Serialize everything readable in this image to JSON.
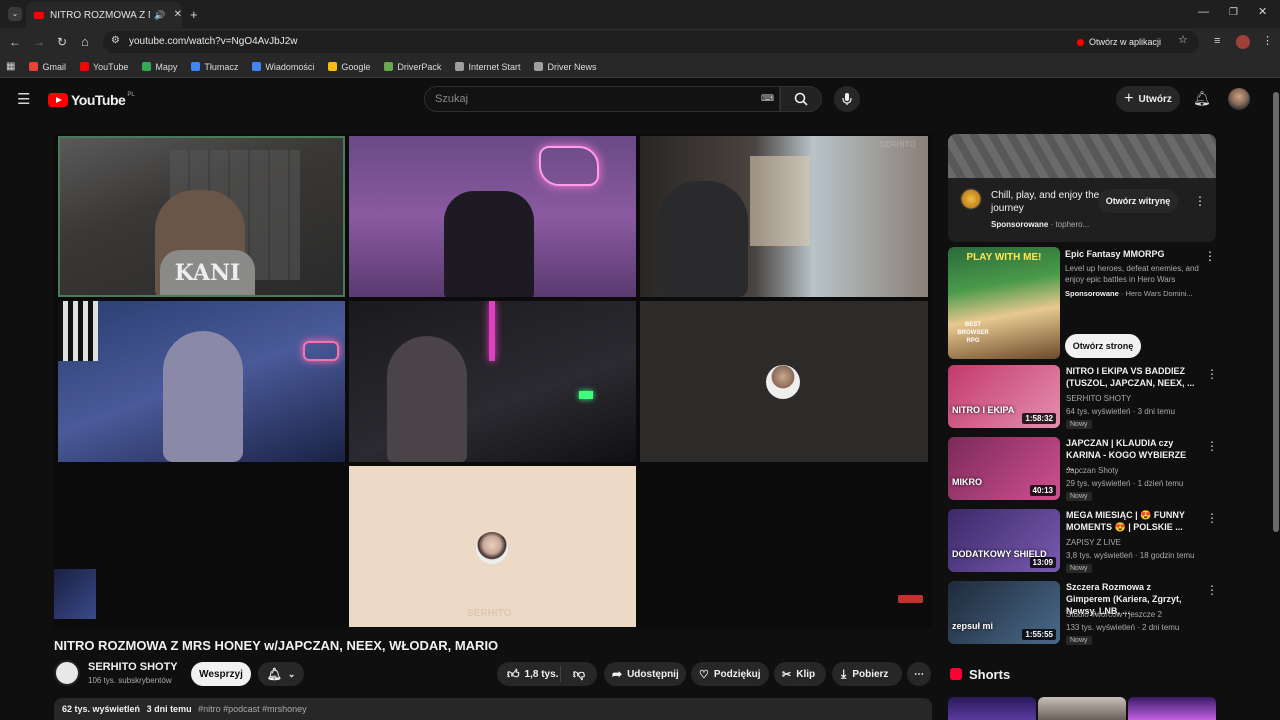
{
  "browser": {
    "tab_title": "NITRO ROZMOWA Z MRS H",
    "url": "youtube.com/watch?v=NgO4AvJbJ2w",
    "open_in_app": "Otwórz w aplikacji",
    "bookmarks": [
      {
        "label": "Gmail",
        "color": "#ea4335"
      },
      {
        "label": "YouTube",
        "color": "#ff0000"
      },
      {
        "label": "Mapy",
        "color": "#34a853"
      },
      {
        "label": "Tłumacz",
        "color": "#4285f4"
      },
      {
        "label": "Wiadomości",
        "color": "#4285f4"
      },
      {
        "label": "Google",
        "color": "#fbbc05"
      },
      {
        "label": "DriverPack",
        "color": "#6aa84f"
      },
      {
        "label": "Internet Start",
        "color": "#9e9e9e"
      },
      {
        "label": "Driver News",
        "color": "#9e9e9e"
      }
    ]
  },
  "header": {
    "logo": "YouTube",
    "logo_region": "PL",
    "search_placeholder": "Szukaj",
    "create_label": "Utwórz"
  },
  "video": {
    "title": "NITRO ROZMOWA Z MRS HONEY w/JAPCZAN, NEEX, WŁODAR, MARIO",
    "channel": "SERHITO SHOTY",
    "subscribers": "106 tys. subskrybentów",
    "support_label": "Wesprzyj",
    "likes": "1,8 tys.",
    "share_label": "Udostępnij",
    "thanks_label": "Podziękuj",
    "clip_label": "Klip",
    "download_label": "Pobierz",
    "views": "62 tys. wyświetleń",
    "date": "3 dni temu",
    "tags": "#nitro #podcast #mrshoney",
    "watermark": "SERHITO",
    "cam_text": "KANI"
  },
  "sidebar": {
    "ad": {
      "title": "Chill, play, and enjoy the journey",
      "sponsored": "Sponsorowane",
      "domain": "tophero...",
      "button": "Otwórz witrynę"
    },
    "ad2": {
      "title": "Epic Fantasy MMORPG",
      "desc": "Level up heroes, defeat enemies, and enjoy epic battles in Hero Wars",
      "sponsored": "Sponsorowane",
      "advertiser": "Hero Wars Domini...",
      "button": "Otwórz stronę",
      "thumb_text": "PLAY WITH ME!",
      "thumb_badge": "BEST BROWSER RPG"
    },
    "videos": [
      {
        "title": "NITRO I EKIPA VS BADDIEZ (TUSZOL, JAPCZAN, NEEX, ...",
        "channel": "SERHITO SHOTY",
        "meta": "64 tys. wyświetleń · 3 dni temu",
        "badge": "Nowy",
        "duration": "1:58:32",
        "thumb_text": "NITRO I EKIPA",
        "colors": [
          "#c23a6b",
          "#e58fb0"
        ]
      },
      {
        "title": "JAPCZAN | KLAUDIA czy KARINA - KOGO WYBIERZE ...",
        "channel": "Japczan Shoty",
        "meta": "29 tys. wyświetleń · 1 dzień temu",
        "badge": "Nowy",
        "duration": "40:13",
        "thumb_text": "MIKRO",
        "colors": [
          "#7a2a5a",
          "#d05090"
        ]
      },
      {
        "title": "MEGA MIESIĄC | 😍 FUNNY MOMENTS 😍 | POLSKIE ...",
        "channel": "ZAPISY Z LIVE",
        "meta": "3,8 tys. wyświetleń · 18 godzin temu",
        "badge": "Nowy",
        "duration": "13:09",
        "thumb_text": "DODATKOWY SHIELD",
        "colors": [
          "#3b2a6a",
          "#7a5ab0"
        ]
      },
      {
        "title": "Szczera Rozmowa z Gimperem (Kariera, Zgrzyt, Newsy, LNB, ...",
        "channel": "Studio Twórców i jeszcze 2",
        "meta": "133 tys. wyświetleń · 2 dni temu",
        "badge": "Nowy",
        "duration": "1:55:55",
        "thumb_text": "zepsuł mi",
        "colors": [
          "#1e2a3a",
          "#4a6a8a"
        ]
      }
    ],
    "shorts_label": "Shorts"
  },
  "colors": {
    "accent": "#ff0000",
    "bg": "#0f0f0f",
    "pill": "#272727"
  }
}
